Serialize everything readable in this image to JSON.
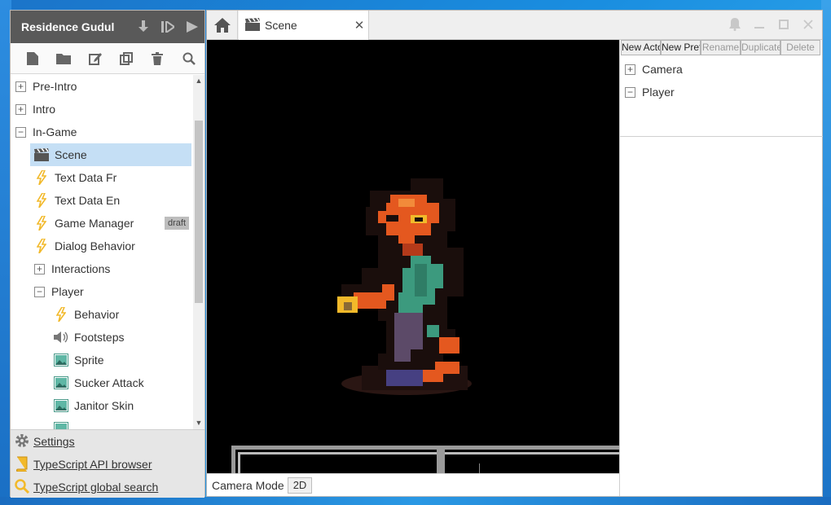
{
  "project": {
    "title": "Residence Gudul"
  },
  "tree": {
    "items": [
      {
        "label": "Pre-Intro"
      },
      {
        "label": "Intro"
      },
      {
        "label": "In-Game"
      },
      {
        "label": "Scene"
      },
      {
        "label": "Text Data Fr"
      },
      {
        "label": "Text Data En"
      },
      {
        "label": "Game Manager",
        "badge": "draft"
      },
      {
        "label": "Dialog Behavior"
      },
      {
        "label": "Interactions"
      },
      {
        "label": "Player"
      },
      {
        "label": "Behavior"
      },
      {
        "label": "Footsteps"
      },
      {
        "label": "Sprite"
      },
      {
        "label": "Sucker Attack"
      },
      {
        "label": "Janitor Skin"
      }
    ]
  },
  "links": {
    "settings": "Settings",
    "api": "TypeScript API browser",
    "search": "TypeScript global search"
  },
  "tabs": {
    "scene": "Scene"
  },
  "camera": {
    "label": "Camera Mode",
    "mode": "2D"
  },
  "inspector": {
    "buttons": [
      "New Actor",
      "New Prefab",
      "Rename",
      "Duplicate",
      "Delete"
    ],
    "items": [
      {
        "label": "Camera"
      },
      {
        "label": "Player"
      }
    ]
  },
  "colors": {
    "header": "#595959",
    "selection": "#c5dff5",
    "accent": "#f2b92a"
  }
}
